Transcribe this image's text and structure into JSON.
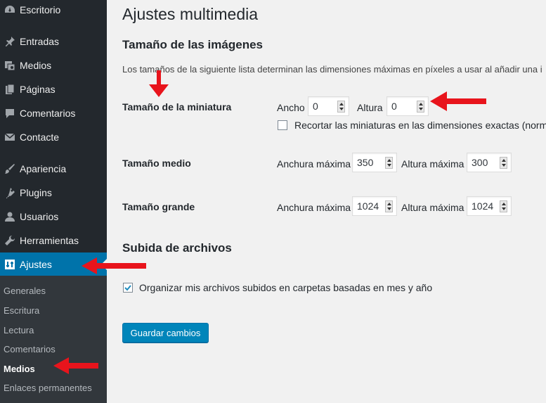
{
  "sidebar": {
    "menu": [
      {
        "label": "Escritorio",
        "icon": "dashboard-icon"
      },
      {
        "label": "Entradas",
        "icon": "pin-icon"
      },
      {
        "label": "Medios",
        "icon": "media-icon"
      },
      {
        "label": "Páginas",
        "icon": "pages-icon"
      },
      {
        "label": "Comentarios",
        "icon": "comments-icon"
      },
      {
        "label": "Contacte",
        "icon": "mail-icon"
      },
      {
        "label": "Apariencia",
        "icon": "brush-icon"
      },
      {
        "label": "Plugins",
        "icon": "plugin-icon"
      },
      {
        "label": "Usuarios",
        "icon": "user-icon"
      },
      {
        "label": "Herramientas",
        "icon": "wrench-icon"
      },
      {
        "label": "Ajustes",
        "icon": "settings-icon"
      }
    ],
    "submenu": [
      "Generales",
      "Escritura",
      "Lectura",
      "Comentarios",
      "Medios",
      "Enlaces permanentes"
    ],
    "active_menu": "Ajustes",
    "current_submenu": "Medios"
  },
  "page": {
    "title": "Ajustes multimedia",
    "section_images": "Tamaño de las imágenes",
    "description": "Los tamaños de la siguiente lista determinan las dimensiones máximas en píxeles a usar al añadir una i",
    "thumbnail": {
      "label": "Tamaño de la miniatura",
      "width_label": "Ancho",
      "width_value": "0",
      "height_label": "Altura",
      "height_value": "0",
      "crop_label": "Recortar las miniaturas en las dimensiones exactas (normalr",
      "crop_checked": false
    },
    "medium": {
      "label": "Tamaño medio",
      "width_label": "Anchura máxima",
      "width_value": "350",
      "height_label": "Altura máxima",
      "height_value": "300"
    },
    "large": {
      "label": "Tamaño grande",
      "width_label": "Anchura máxima",
      "width_value": "1024",
      "height_label": "Altura máxima",
      "height_value": "1024"
    },
    "section_uploads": "Subida de archivos",
    "organize_label": "Organizar mis archivos subidos en carpetas basadas en mes y año",
    "organize_checked": true,
    "save_button": "Guardar cambios"
  },
  "colors": {
    "sidebar_bg": "#23282d",
    "submenu_bg": "#32373c",
    "active_bg": "#0073aa",
    "button_bg": "#0085ba",
    "annotation_arrow": "#e8141c"
  }
}
